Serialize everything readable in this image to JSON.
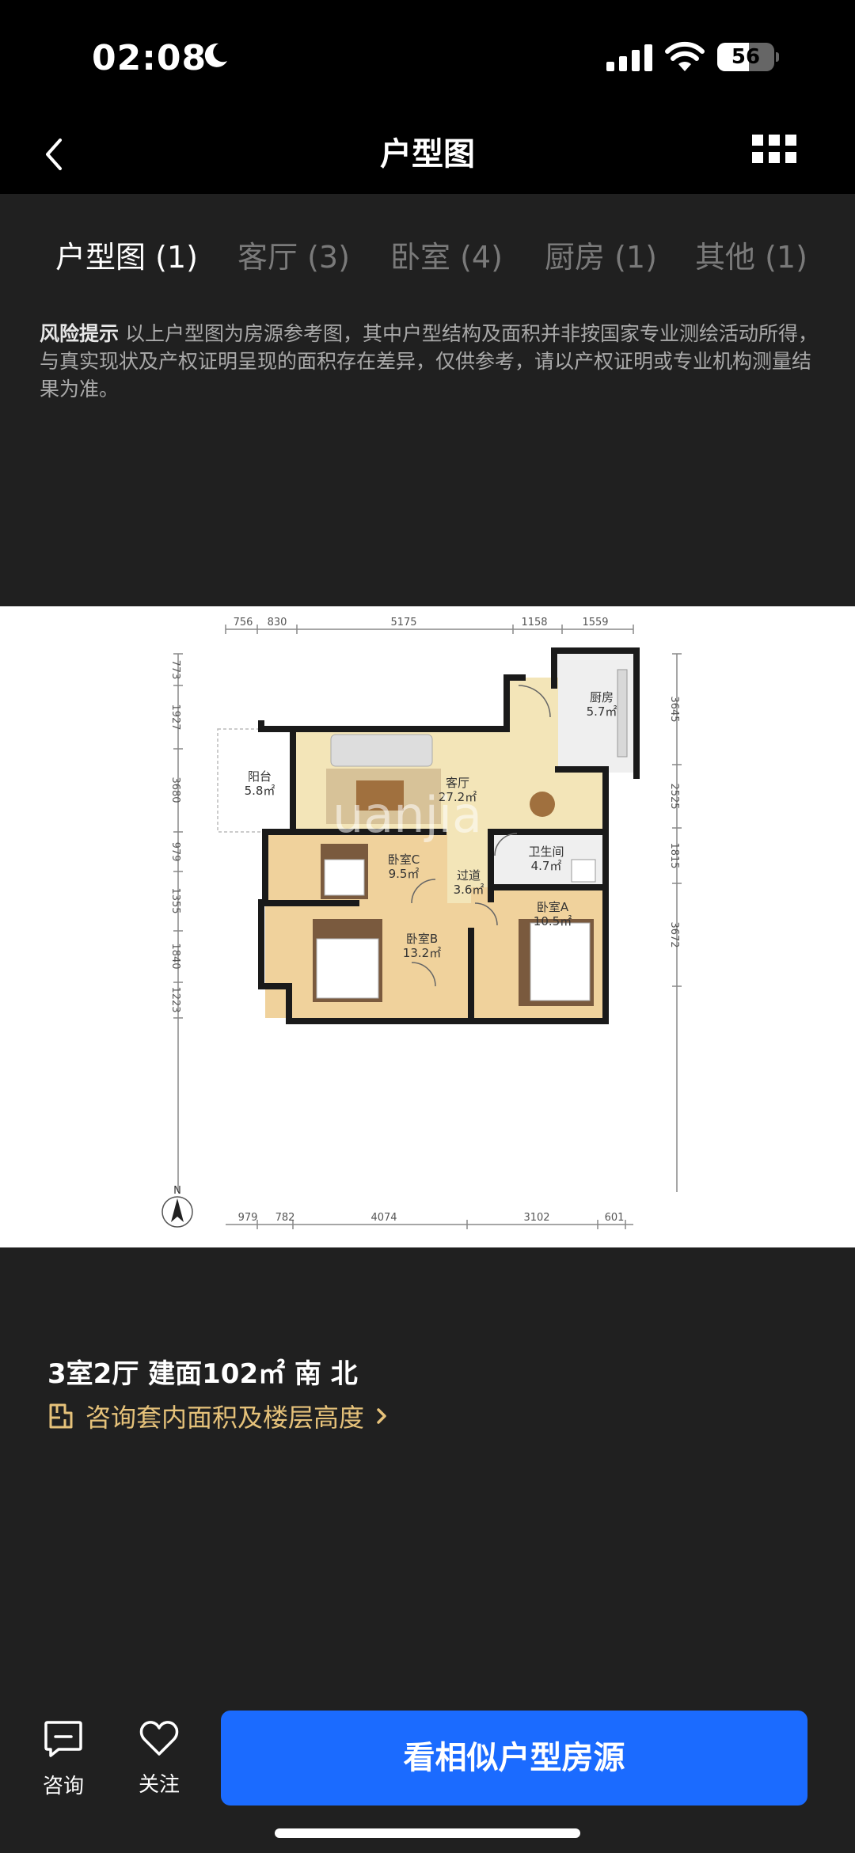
{
  "status": {
    "time": "02:08",
    "battery": "56",
    "battery_level": 0.56,
    "icons": [
      "moon-icon",
      "signal-icon",
      "wifi-icon",
      "battery-icon"
    ]
  },
  "nav": {
    "title": "户型图",
    "icons": [
      "chevron-left-icon",
      "grid-icon"
    ]
  },
  "tabs": [
    {
      "label": "户型图 (1)",
      "active": true
    },
    {
      "label": "客厅 (3)",
      "active": false
    },
    {
      "label": "卧室 (4)",
      "active": false
    },
    {
      "label": "厨房 (1)",
      "active": false
    },
    {
      "label": "其他 (1)",
      "active": false
    }
  ],
  "risk": {
    "title": "风险提示",
    "text": "以上户型图为房源参考图，其中户型结构及面积并非按国家专业测绘活动所得，与真实现状及产权证明呈现的面积存在差异，仅供参考，请以产权证明或专业机构测量结果为准。"
  },
  "floorplan": {
    "dims_top": [
      "756",
      "830",
      "5175",
      "1158",
      "1559"
    ],
    "dims_bottom": [
      "979",
      "782",
      "4074",
      "3102",
      "601"
    ],
    "dims_left": [
      "773",
      "1927",
      "3680",
      "979",
      "1355",
      "1840",
      "1223"
    ],
    "dims_right": [
      "3645",
      "2525",
      "1815",
      "3672"
    ],
    "rooms": [
      {
        "name": "厨房",
        "area": "5.7㎡"
      },
      {
        "name": "阳台",
        "area": "5.8㎡"
      },
      {
        "name": "客厅",
        "area": "27.2㎡"
      },
      {
        "name": "卫生间",
        "area": "4.7㎡"
      },
      {
        "name": "卧室C",
        "area": "9.5㎡"
      },
      {
        "name": "过道",
        "area": "3.6㎡"
      },
      {
        "name": "卧室A",
        "area": "10.5㎡"
      },
      {
        "name": "卧室B",
        "area": "13.2㎡"
      }
    ],
    "compass": "N",
    "watermark": "uanjia"
  },
  "info": {
    "summary": "3室2厅  建面102㎡  南 北",
    "consult_link": "咨询套内面积及楼层高度",
    "accent_color": "#e6c27a"
  },
  "bottom": {
    "consult_label": "咨询",
    "follow_label": "关注",
    "similar_button": "看相似户型房源",
    "button_color": "#1b6bff"
  }
}
